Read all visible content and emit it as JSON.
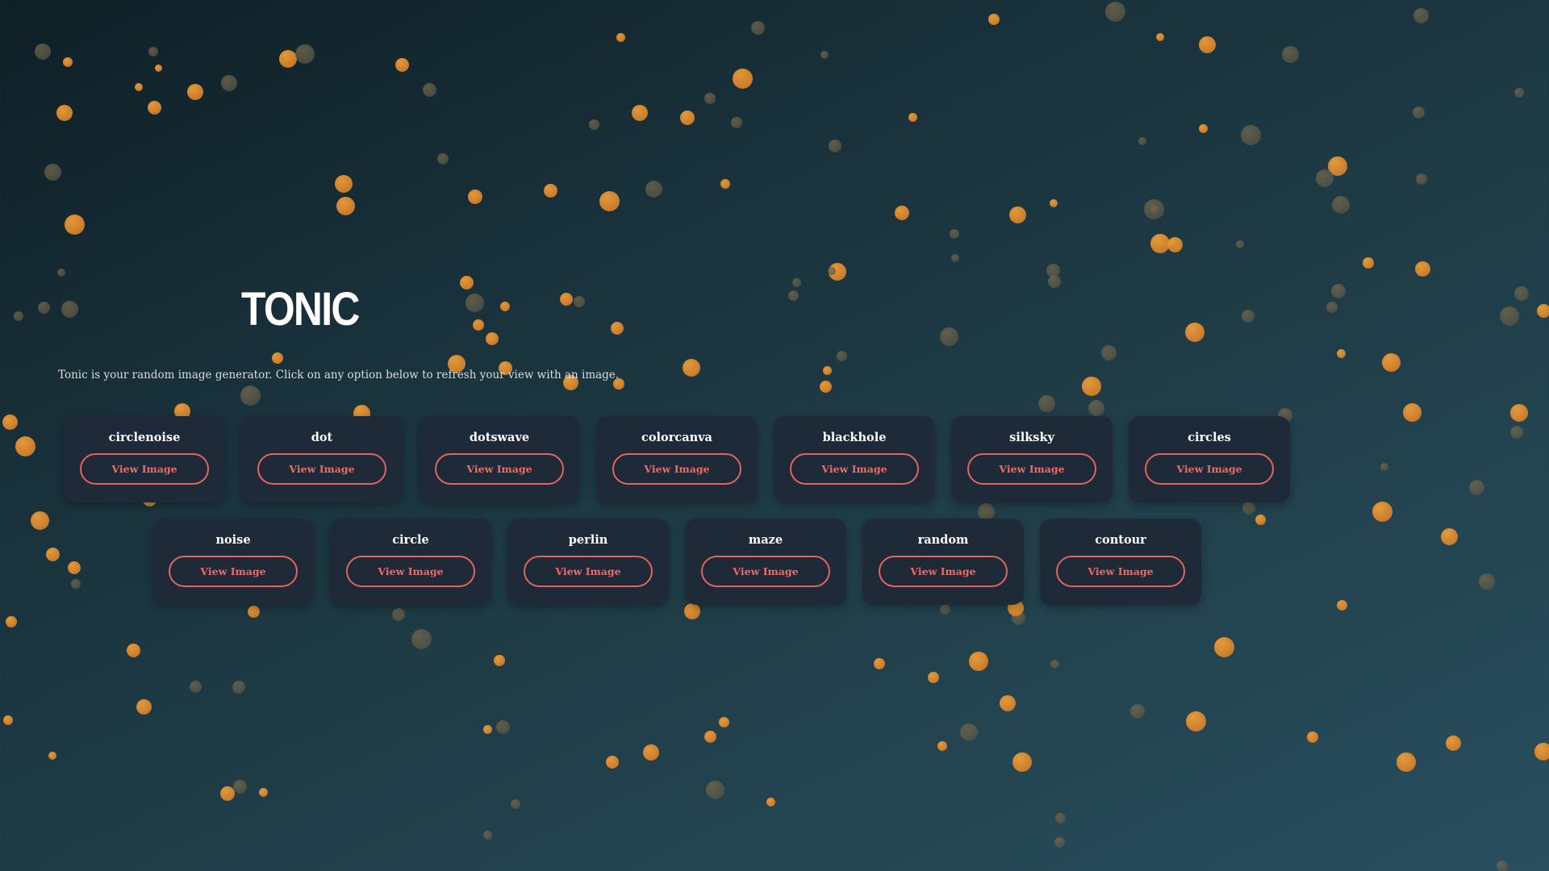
{
  "app": {
    "logo": "TONIC",
    "tagline": "Tonic is your random image generator. Click on any option below to refresh your view with an image."
  },
  "generators": [
    {
      "name": "circlenoise",
      "button_label": "View Image"
    },
    {
      "name": "dot",
      "button_label": "View Image"
    },
    {
      "name": "dotswave",
      "button_label": "View Image"
    },
    {
      "name": "colorcanva",
      "button_label": "View Image"
    },
    {
      "name": "blackhole",
      "button_label": "View Image"
    },
    {
      "name": "silksky",
      "button_label": "View Image"
    },
    {
      "name": "circles",
      "button_label": "View Image"
    },
    {
      "name": "noise",
      "button_label": "View Image"
    },
    {
      "name": "circle",
      "button_label": "View Image"
    },
    {
      "name": "perlin",
      "button_label": "View Image"
    },
    {
      "name": "maze",
      "button_label": "View Image"
    },
    {
      "name": "random",
      "button_label": "View Image"
    },
    {
      "name": "contour",
      "button_label": "View Image"
    }
  ],
  "colors": {
    "accent": "#ef6b62",
    "card_background": "#1f2a38",
    "dot_orange": "#e89434",
    "dot_gray": "#5f5a47"
  }
}
